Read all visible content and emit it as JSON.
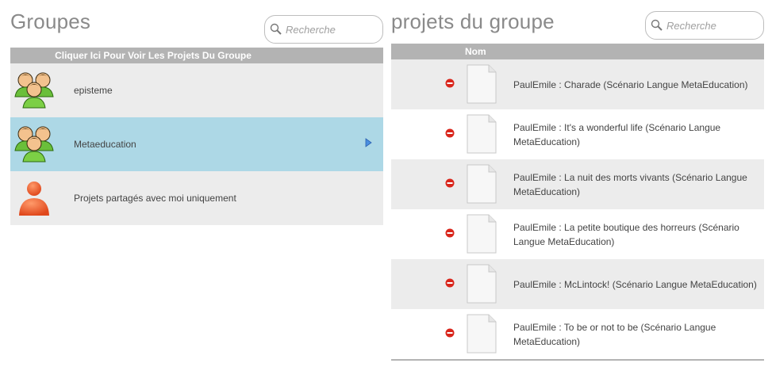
{
  "groups_panel": {
    "title": "Groupes",
    "search_placeholder": "Recherche",
    "header": "Cliquer Ici Pour Voir Les Projets Du Groupe",
    "items": [
      {
        "label": "episteme",
        "icon": "group-icon",
        "selected": false
      },
      {
        "label": "Metaeducation",
        "icon": "group-icon",
        "selected": true
      },
      {
        "label": "Projets partagés avec moi uniquement",
        "icon": "user-icon",
        "selected": false
      }
    ]
  },
  "projects_panel": {
    "title": "projets du groupe",
    "search_placeholder": "Recherche",
    "header": "Nom",
    "items": [
      {
        "label": "PaulEmile : Charade (Scénario Langue MetaEducation)"
      },
      {
        "label": "PaulEmile : It's a wonderful life (Scénario Langue MetaEducation)"
      },
      {
        "label": "PaulEmile : La nuit des morts vivants (Scénario Langue MetaEducation)"
      },
      {
        "label": "PaulEmile : La petite boutique des horreurs (Scénario Langue MetaEducation)"
      },
      {
        "label": "PaulEmile : McLintock! (Scénario Langue MetaEducation)"
      },
      {
        "label": "PaulEmile : To be or not to be (Scénario Langue MetaEducation)"
      }
    ]
  },
  "colors": {
    "header_bg": "#b3b3b3",
    "row_bg": "#ececec",
    "selected_bg": "#add8e6",
    "remove_red": "#d9261c",
    "title_gray": "#8a8a8a"
  }
}
